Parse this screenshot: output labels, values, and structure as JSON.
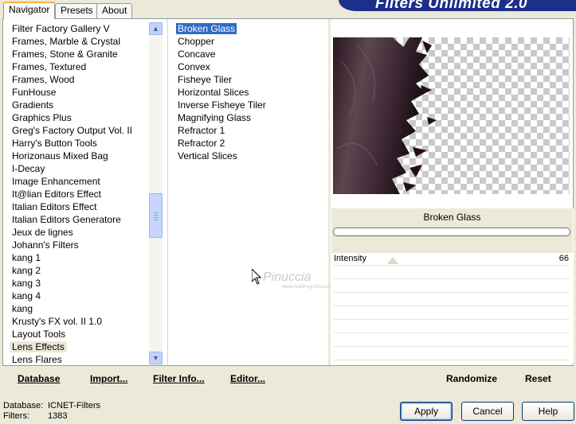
{
  "banner": {
    "title": "Filters Unlimited 2.0"
  },
  "tabs": [
    {
      "label": "Navigator"
    },
    {
      "label": "Presets"
    },
    {
      "label": "About"
    }
  ],
  "categories": [
    "Filter Factory Gallery V",
    "Frames, Marble & Crystal",
    "Frames, Stone & Granite",
    "Frames, Textured",
    "Frames, Wood",
    "FunHouse",
    "Gradients",
    "Graphics Plus",
    "Greg's Factory Output Vol. II",
    "Harry's Button Tools",
    "Horizonaus Mixed Bag",
    "I-Decay",
    "Image Enhancement",
    "It@lian Editors Effect",
    "Italian Editors Effect",
    "Italian Editors Generatore",
    "Jeux de lignes",
    "Johann's Filters",
    "kang 1",
    "kang 2",
    "kang 3",
    "kang 4",
    "kang",
    "Krusty's FX vol. II 1.0",
    "Layout Tools",
    "Lens Effects",
    "Lens Flares"
  ],
  "selected_category": "Lens Effects",
  "filters": [
    "Broken Glass",
    "Chopper",
    "Concave",
    "Convex",
    "Fisheye Tiler",
    "Horizontal Slices",
    "Inverse Fisheye Tiler",
    "Magnifying Glass",
    "Refractor 1",
    "Refractor 2",
    "Vertical Slices"
  ],
  "selected_filter": "Broken Glass",
  "preview": {
    "filter_name": "Broken Glass"
  },
  "parameters": [
    {
      "label": "Intensity",
      "value": "66"
    }
  ],
  "toolbar": {
    "database": "Database",
    "import": "Import...",
    "filter_info": "Filter Info...",
    "editor": "Editor...",
    "randomize": "Randomize",
    "reset": "Reset"
  },
  "footer": {
    "database_label": "Database:",
    "database_value": "ICNET-Filters",
    "filters_label": "Filters:",
    "filters_value": "1383"
  },
  "buttons": {
    "apply": "Apply",
    "cancel": "Cancel",
    "help": "Help"
  },
  "watermark": {
    "name": "Pinuccia",
    "site": "www.maidiregrafica.eu"
  },
  "colors": {
    "banner": "#1c2f8a",
    "selection": "#316ac5",
    "face": "#ece9d8"
  },
  "icons": [
    "scroll-up-icon",
    "scroll-down-icon",
    "mouse-pointer-icon"
  ]
}
